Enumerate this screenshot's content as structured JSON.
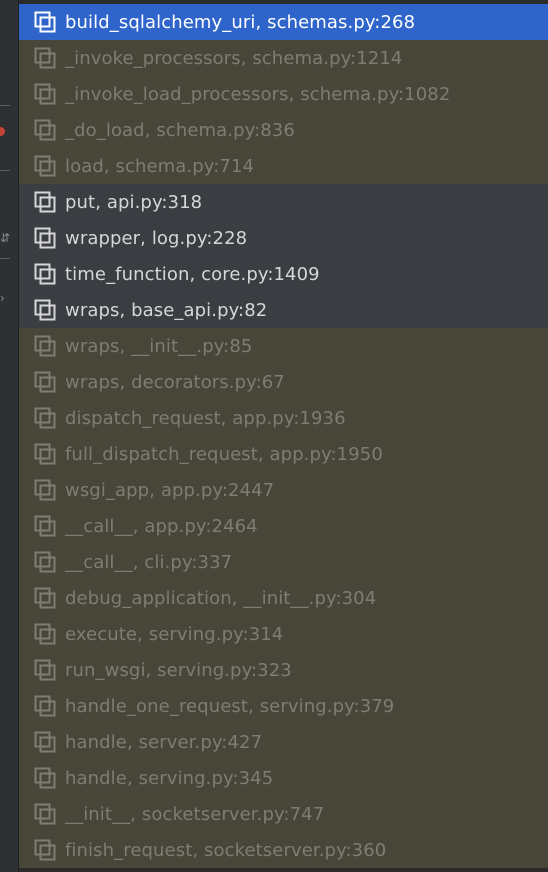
{
  "frames": [
    {
      "label": "build_sqlalchemy_uri, schemas.py:268",
      "kind": "selected"
    },
    {
      "label": "_invoke_processors, schema.py:1214",
      "kind": "library"
    },
    {
      "label": "_invoke_load_processors, schema.py:1082",
      "kind": "library"
    },
    {
      "label": "_do_load, schema.py:836",
      "kind": "library"
    },
    {
      "label": "load, schema.py:714",
      "kind": "library"
    },
    {
      "label": "put, api.py:318",
      "kind": "project"
    },
    {
      "label": "wrapper, log.py:228",
      "kind": "project"
    },
    {
      "label": "time_function, core.py:1409",
      "kind": "project"
    },
    {
      "label": "wraps, base_api.py:82",
      "kind": "project"
    },
    {
      "label": "wraps, __init__.py:85",
      "kind": "library"
    },
    {
      "label": "wraps, decorators.py:67",
      "kind": "library"
    },
    {
      "label": "dispatch_request, app.py:1936",
      "kind": "library"
    },
    {
      "label": "full_dispatch_request, app.py:1950",
      "kind": "library"
    },
    {
      "label": "wsgi_app, app.py:2447",
      "kind": "library"
    },
    {
      "label": "__call__, app.py:2464",
      "kind": "library"
    },
    {
      "label": "__call__, cli.py:337",
      "kind": "library"
    },
    {
      "label": "debug_application, __init__.py:304",
      "kind": "library"
    },
    {
      "label": "execute, serving.py:314",
      "kind": "library"
    },
    {
      "label": "run_wsgi, serving.py:323",
      "kind": "library"
    },
    {
      "label": "handle_one_request, serving.py:379",
      "kind": "library"
    },
    {
      "label": "handle, server.py:427",
      "kind": "library"
    },
    {
      "label": "handle, serving.py:345",
      "kind": "library"
    },
    {
      "label": "__init__, socketserver.py:747",
      "kind": "library"
    },
    {
      "label": "finish_request, socketserver.py:360",
      "kind": "library"
    }
  ],
  "icons": {
    "frame": "stack-frame-icon",
    "breakpoint": "breakpoint-dot-icon"
  },
  "colors": {
    "selected_bg": "#2f65ca",
    "project_bg": "#3a3d41",
    "library_bg": "#484539"
  }
}
